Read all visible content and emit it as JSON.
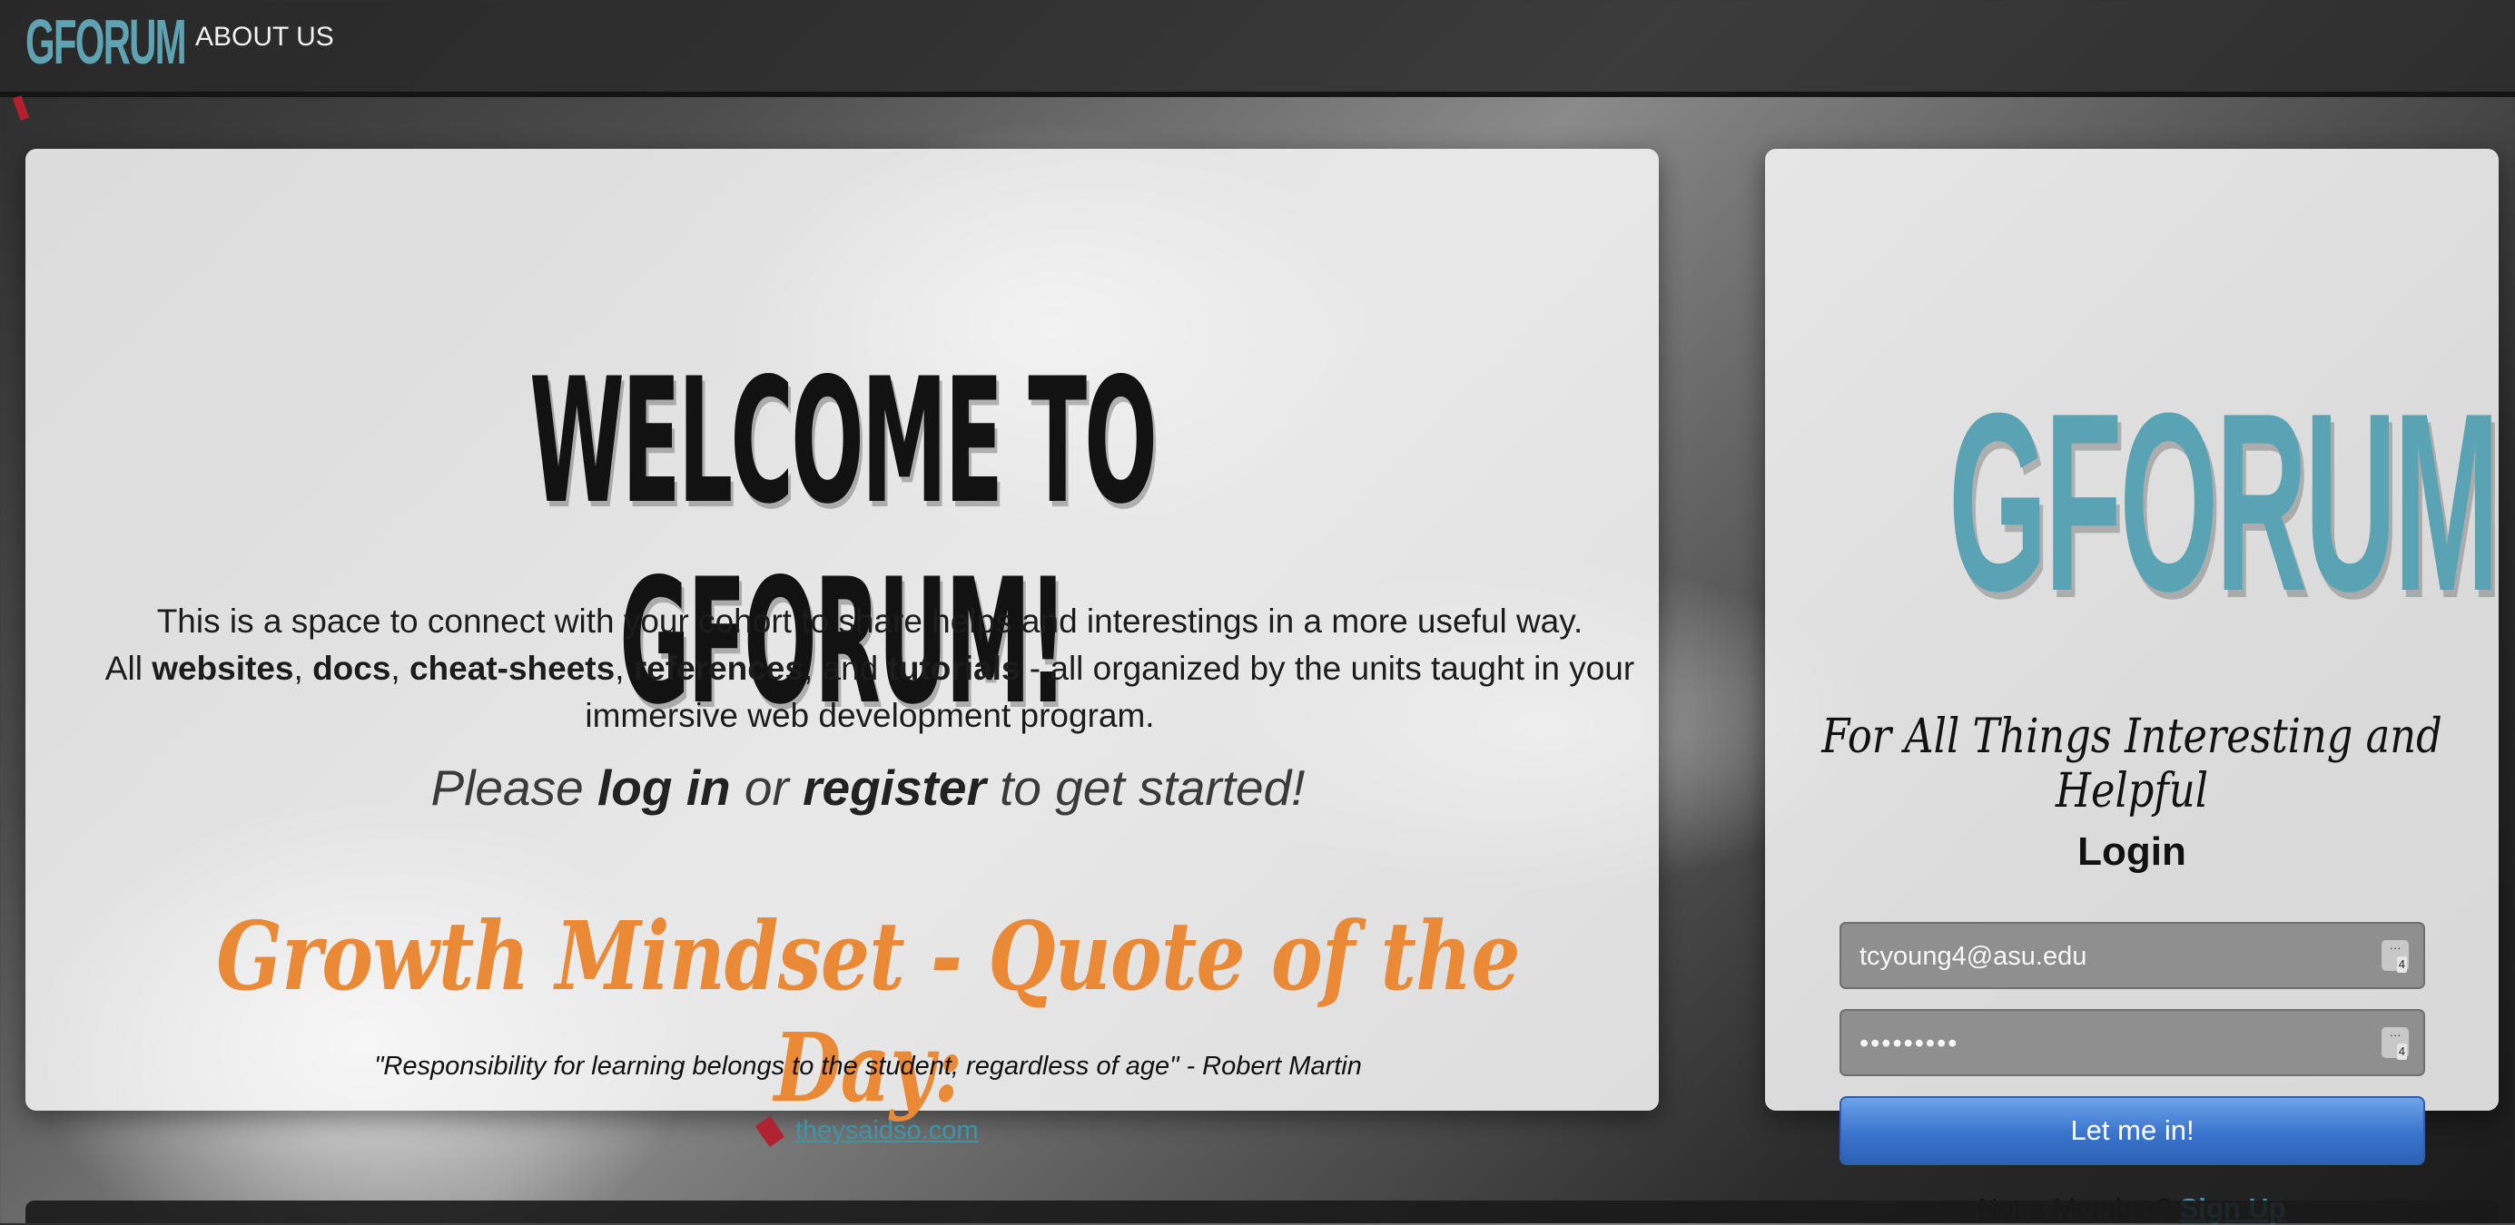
{
  "nav": {
    "brand": "GFORUM",
    "about": "ABOUT US"
  },
  "welcome": {
    "title": "WELCOME TO GFORUM!",
    "intro_line1": "This is a space to connect with your cohort to share helps and interestings in a more useful way.",
    "intro_line2_prefix": "All ",
    "intro_websites": "websites",
    "intro_sep1": ", ",
    "intro_docs": "docs",
    "intro_sep2": ", ",
    "intro_cheatsheets": "cheat-sheets",
    "intro_sep3": ", ",
    "intro_references": "references",
    "intro_sep4": ", and ",
    "intro_tutorials": "tutorials",
    "intro_suffix": " - all organized by the units taught in your",
    "intro_line3": "immersive web development program.",
    "cta_please": "Please ",
    "cta_login": "log in",
    "cta_or": " or ",
    "cta_register": "register",
    "cta_end": " to get started!",
    "quote_heading": "Growth Mindset - Quote of the Day:",
    "quote": "\"Responsibility for learning belongs to the student, regardless of age\" - Robert Martin",
    "source": "theysaidso.com"
  },
  "login": {
    "logo": "GFORUM",
    "tagline": "For All Things Interesting and Helpful",
    "heading": "Login",
    "email_value": "tcyoung4@asu.edu",
    "password_value": "•••••••••",
    "submit": "Let me in!",
    "not_member": "Not a Member? ",
    "signup": "Sign Up"
  },
  "colors": {
    "accent": "#5fa3b3",
    "quote_orange": "#ea8a36",
    "button_blue": "#3a74cc"
  },
  "icons": {
    "password_manager": "key-icon",
    "source": "quote-source-icon"
  }
}
